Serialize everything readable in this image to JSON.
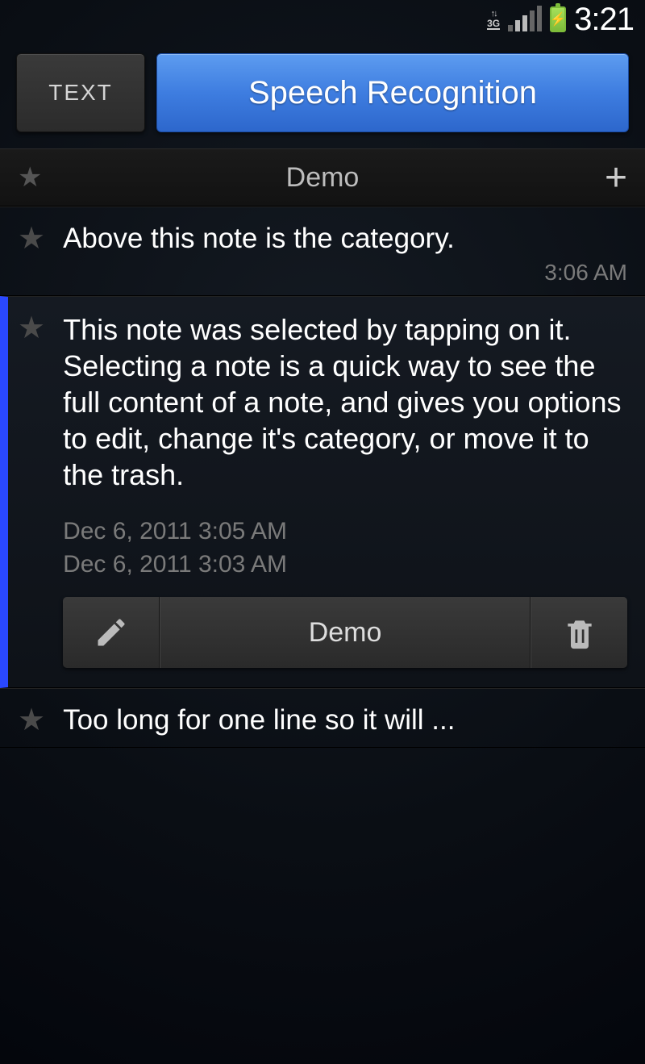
{
  "status_bar": {
    "network": "3G",
    "time": "3:21"
  },
  "tabs": {
    "text_label": "TEXT",
    "speech_label": "Speech Recognition"
  },
  "category_header": {
    "title": "Demo"
  },
  "notes": [
    {
      "text": "Above this note is the category.",
      "time": "3:06 AM"
    },
    {
      "text": "This note was selected by tapping on it. Selecting a note is a quick way to see the full content of a note, and gives you options to edit, change it's category, or move it to the trash.",
      "timestamps": [
        "Dec 6, 2011 3:05 AM",
        "Dec 6, 2011 3:03 AM"
      ],
      "category_button": "Demo"
    },
    {
      "text": "Too long for one line so it will ..."
    }
  ]
}
